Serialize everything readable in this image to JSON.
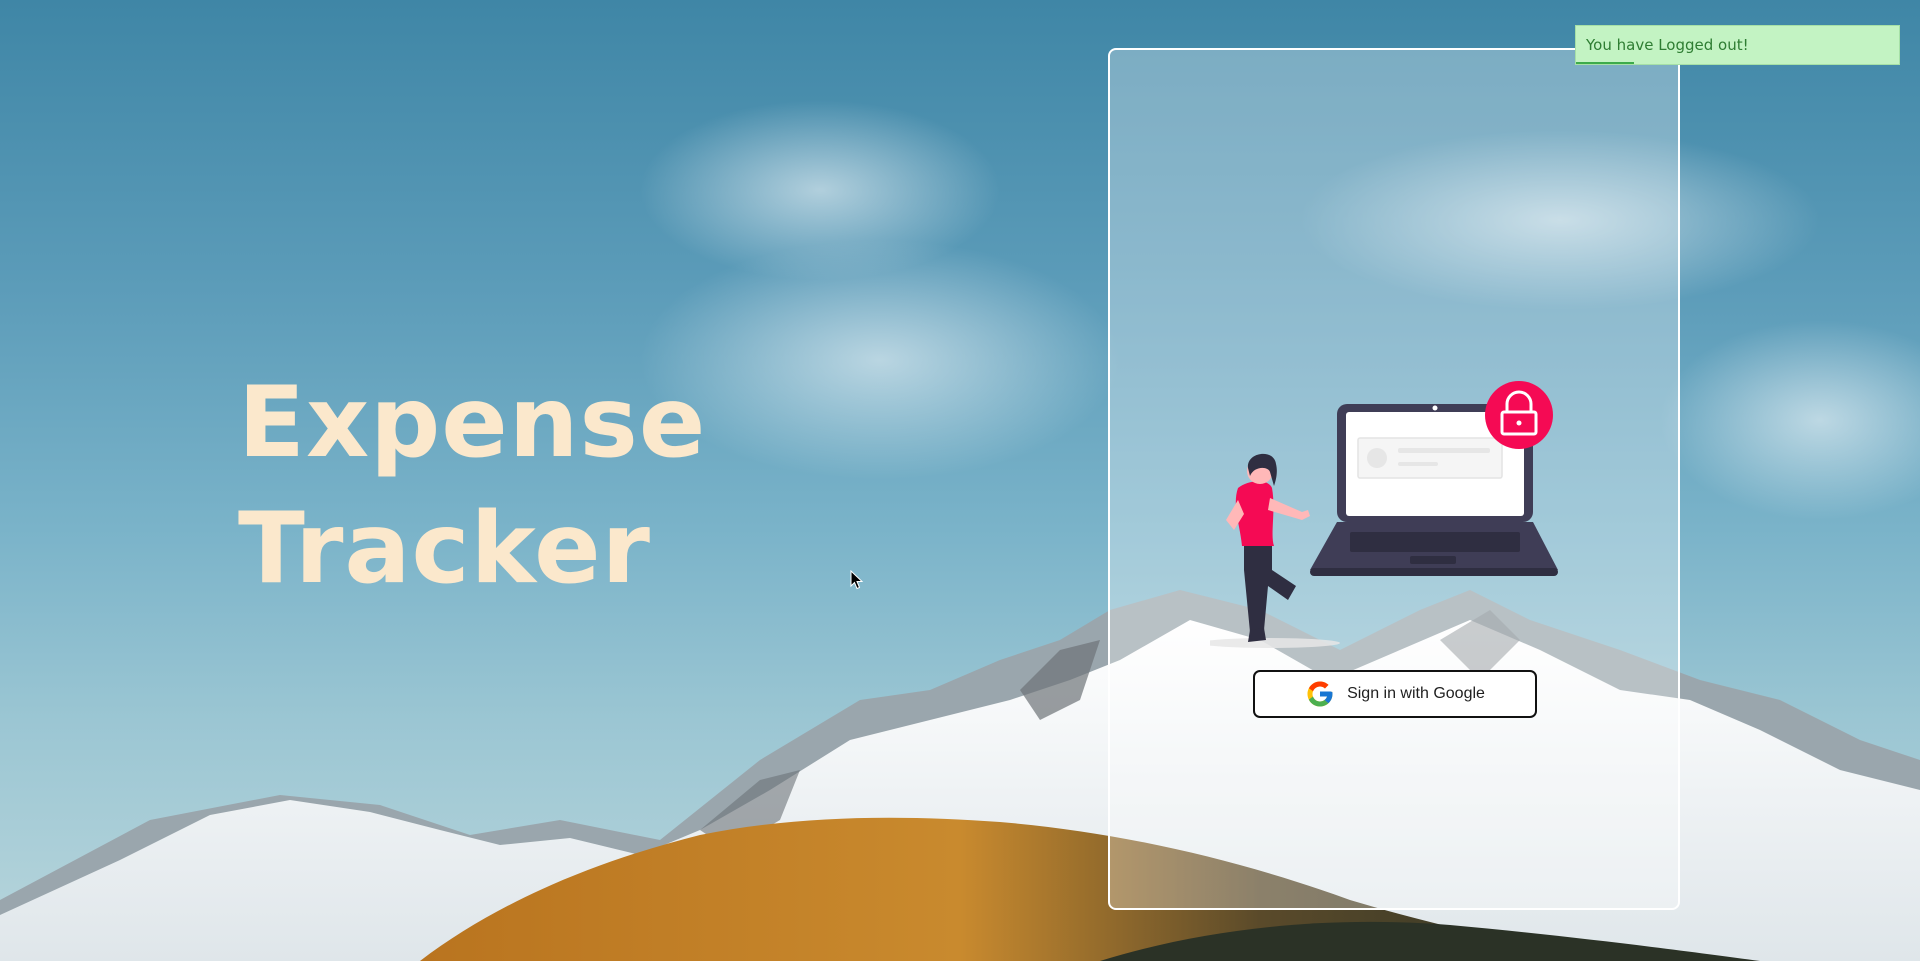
{
  "app": {
    "title_line1": "Expense",
    "title_line2": "Tracker"
  },
  "login": {
    "google_button_label": "Sign in with Google",
    "illustration_icon": "laptop-lock-illustration",
    "google_icon": "google-g-icon"
  },
  "toast": {
    "message": "You have Logged out!",
    "progress": 0.18
  },
  "colors": {
    "title": "#fbe8cc",
    "toast_background": "#c3f3c3",
    "toast_text": "#2e7d32",
    "accent_pink": "#f50a54",
    "laptop_dark": "#3f3d56"
  }
}
